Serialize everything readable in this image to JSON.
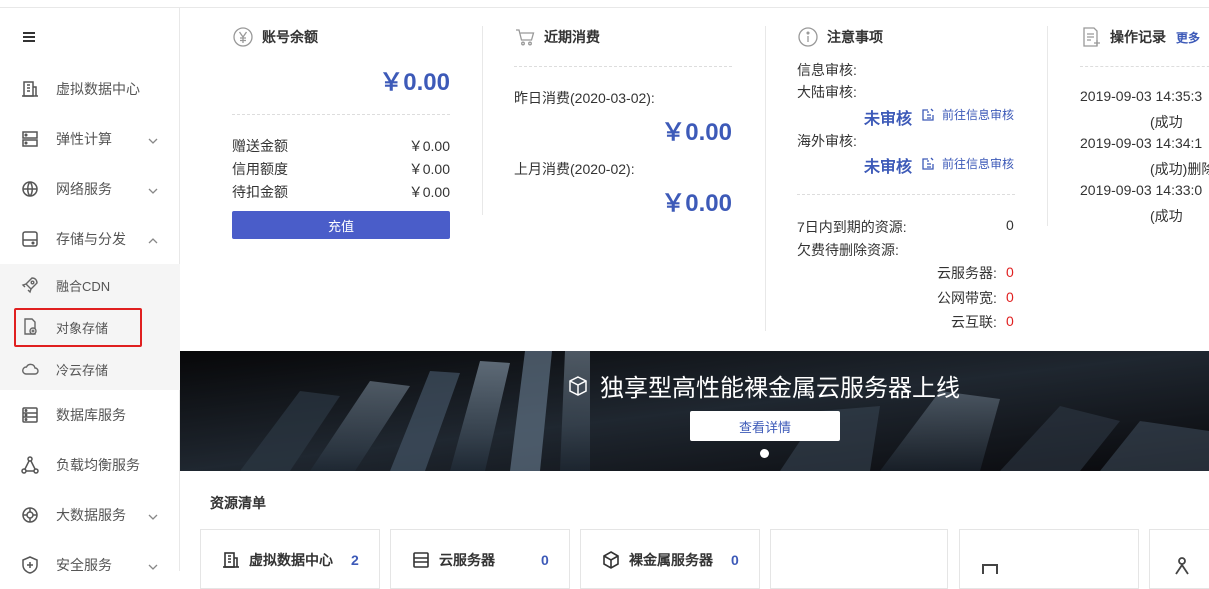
{
  "sidebar": {
    "menu_icon": "hamburger-icon",
    "items": [
      {
        "label": "虚拟数据中心",
        "icon": "building-icon"
      },
      {
        "label": "弹性计算",
        "icon": "server-icon"
      },
      {
        "label": "网络服务",
        "icon": "globe-icon"
      },
      {
        "label": "存储与分发",
        "icon": "storage-icon"
      },
      {
        "label": "数据库服务",
        "icon": "database-icon"
      },
      {
        "label": "负载均衡服务",
        "icon": "loadbalance-icon"
      },
      {
        "label": "大数据服务",
        "icon": "bigdata-icon"
      },
      {
        "label": "安全服务",
        "icon": "shield-icon"
      }
    ],
    "subitems": [
      {
        "label": "融合CDN",
        "icon": "rocket-icon"
      },
      {
        "label": "对象存储",
        "icon": "file-storage-icon"
      },
      {
        "label": "冷云存储",
        "icon": "cloud-icon"
      }
    ]
  },
  "balance": {
    "title": "账号余额",
    "amount": "￥0.00",
    "rows": [
      {
        "label": "赠送金额",
        "value": "￥0.00"
      },
      {
        "label": "信用额度",
        "value": "￥0.00"
      },
      {
        "label": "待扣金额",
        "value": "￥0.00"
      }
    ],
    "recharge": "充值"
  },
  "consumption": {
    "title": "近期消费",
    "yesterday_label": "昨日消费(2020-03-02):",
    "yesterday_amount": "￥0.00",
    "lastmonth_label": "上月消费(2020-02):",
    "lastmonth_amount": "￥0.00"
  },
  "notice": {
    "title": "注意事项",
    "info_review": "信息审核:",
    "mainland_review": "大陆审核:",
    "mainland_status": "未审核",
    "mainland_link": "前往信息审核",
    "overseas_review": "海外审核:",
    "overseas_status": "未审核",
    "overseas_link": "前往信息审核",
    "expiring_label": "7日内到期的资源:",
    "expiring_value": "0",
    "arrears_label": "欠费待删除资源:",
    "arrears": [
      {
        "label": "云服务器:",
        "value": "0"
      },
      {
        "label": "公网带宽:",
        "value": "0"
      },
      {
        "label": "云互联:",
        "value": "0"
      }
    ]
  },
  "oplog": {
    "title": "操作记录",
    "more": "更多",
    "entries": [
      {
        "time": "2019-09-03 14:35:3",
        "result": "(成功"
      },
      {
        "time": "2019-09-03 14:34:1",
        "result": "(成功)删除"
      },
      {
        "time": "2019-09-03 14:33:0",
        "result": "(成功"
      }
    ]
  },
  "banner": {
    "title": "独享型高性能裸金属云服务器上线",
    "button": "查看详情"
  },
  "resources": {
    "title": "资源清单",
    "cards": [
      {
        "label": "虚拟数据中心",
        "count": "2",
        "icon": "building-icon"
      },
      {
        "label": "云服务器",
        "count": "0",
        "icon": "server-icon"
      },
      {
        "label": "裸金属服务器",
        "count": "0",
        "icon": "cube-icon"
      }
    ]
  }
}
